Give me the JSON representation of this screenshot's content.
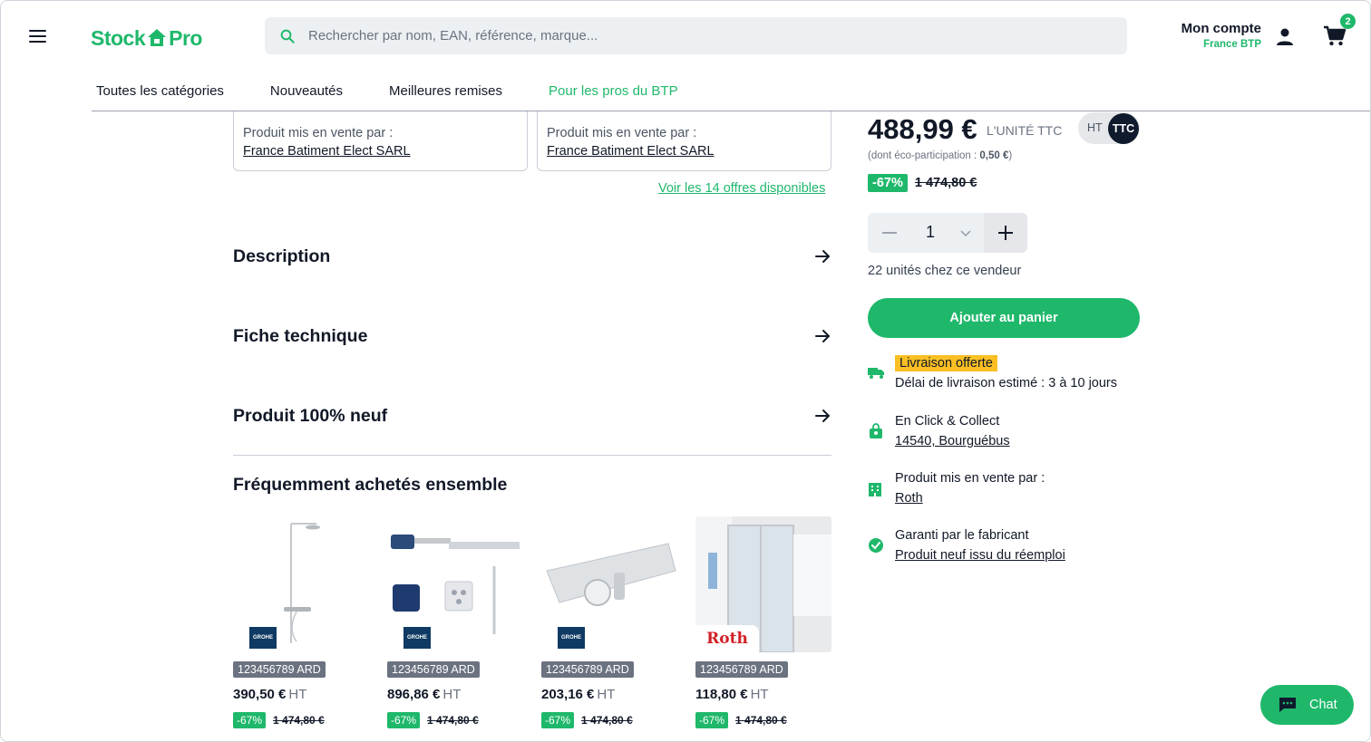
{
  "header": {
    "logo_left": "Stock",
    "logo_right": "Pro",
    "search_placeholder": "Rechercher par nom, EAN, référence, marque...",
    "account_label": "Mon compte",
    "account_sub": "France BTP",
    "cart_count": "2"
  },
  "nav": {
    "items": [
      "Toutes les catégories",
      "Nouveautés",
      "Meilleures remises",
      "Pour les pros du BTP"
    ]
  },
  "sellers": {
    "cards": [
      {
        "label": "Produit mis en vente par :",
        "seller": "France Batiment Elect SARL"
      },
      {
        "label": "Produit mis en vente par :",
        "seller": "France Batiment Elect SARL"
      }
    ],
    "offers_link": "Voir les 14 offres disponibles"
  },
  "accordion": [
    "Description",
    "Fiche technique",
    "Produit 100% neuf"
  ],
  "frequent": {
    "title": "Fréquemment achetés ensemble",
    "products": [
      {
        "ref": "123456789 ARD",
        "price": "390,50 €",
        "ht": "HT",
        "discount": "-67%",
        "old": "1 474,80 €",
        "brand": "GROHE"
      },
      {
        "ref": "123456789 ARD",
        "price": "896,86 €",
        "ht": "HT",
        "discount": "-67%",
        "old": "1 474,80 €",
        "brand": "GROHE"
      },
      {
        "ref": "123456789 ARD",
        "price": "203,16 €",
        "ht": "HT",
        "discount": "-67%",
        "old": "1 474,80 €",
        "brand": "GROHE"
      },
      {
        "ref": "123456789 ARD",
        "price": "118,80 €",
        "ht": "HT",
        "discount": "-67%",
        "old": "1 474,80 €",
        "brand": "Roth"
      }
    ]
  },
  "buybox": {
    "price": "488,99 €",
    "unit": "L'UNITÉ TTC",
    "toggle_ht": "HT",
    "toggle_ttc": "TTC",
    "eco_label": "(dont éco-participation : ",
    "eco_value": "0,50 €",
    "eco_end": ")",
    "discount": "-67%",
    "old_price": "1 474,80 €",
    "quantity": "1",
    "stock": "22 unités chez ce vendeur",
    "add_to_cart": "Ajouter au panier"
  },
  "info": {
    "delivery_badge": "Livraison offerte",
    "delivery_time": "Délai de livraison estimé : 3 à 10 jours",
    "click_collect": "En Click & Collect",
    "click_collect_place": "14540, Bourguébus",
    "seller_label": "Produit mis en vente par :",
    "seller_name": "Roth",
    "warranty": "Garanti par le fabricant",
    "warranty_link": "Produit neuf issu du réemploi"
  },
  "chat": {
    "label": "Chat"
  },
  "colors": {
    "brand": "#1fb86b",
    "highlight": "#fbbf24",
    "dark": "#0f1b2d"
  }
}
